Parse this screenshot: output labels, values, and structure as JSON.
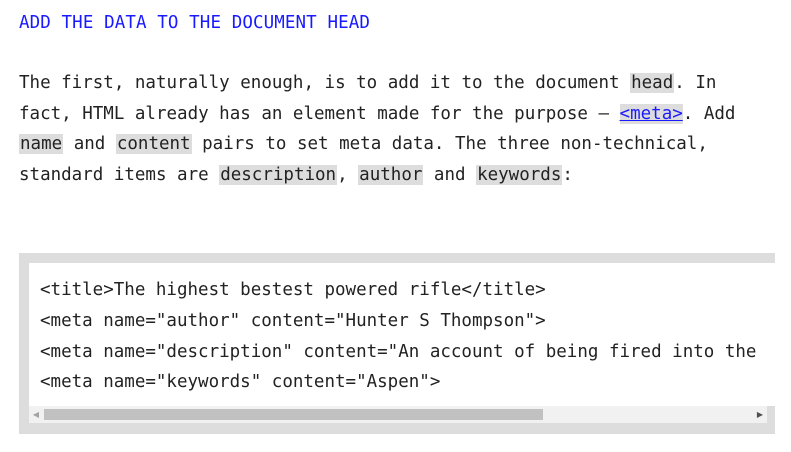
{
  "section": {
    "heading": "ADD THE DATA TO THE DOCUMENT HEAD"
  },
  "paragraph": {
    "t1": "The first, naturally enough, is to add it to the document ",
    "code_head": "head",
    "t2": ". In fact, HTML already has an element made for the purpose – ",
    "link_meta": "<meta>",
    "t3": ". Add ",
    "code_name": "name",
    "t4": " and ",
    "code_content": "content",
    "t5": " pairs to set meta data. The three non-technical, standard items are ",
    "code_description": "description",
    "t6": ", ",
    "code_author": "author",
    "t7": " and ",
    "code_keywords": "keywords",
    "t8": ":"
  },
  "code_block": {
    "lines": [
      "<title>The highest bestest powered rifle</title>",
      "<meta name=\"author\" content=\"Hunter S Thompson\">",
      "<meta name=\"description\" content=\"An account of being fired into the",
      "<meta name=\"keywords\" content=\"Aspen\">"
    ]
  },
  "scrollbar": {
    "left_arrow_icon": "triangle-left",
    "right_arrow_icon": "triangle-right",
    "thumb_position_fraction": 0.0,
    "visible_fraction": 0.69
  },
  "colors": {
    "link": "#1a1aff",
    "text": "#222222",
    "inline_code_bg": "#dddddd",
    "code_frame": "#dddddd"
  }
}
